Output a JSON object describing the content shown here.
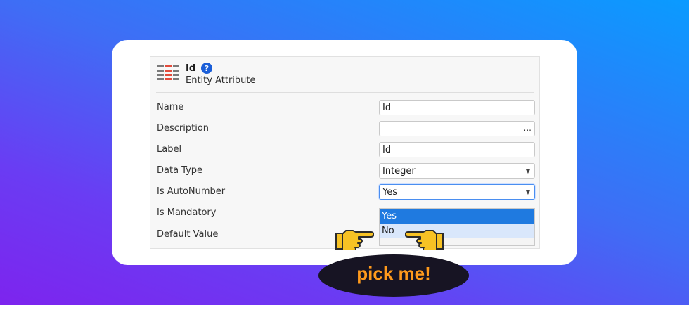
{
  "entity": {
    "title": "Id",
    "help": "?",
    "subtitle": "Entity Attribute"
  },
  "rows": {
    "name": {
      "label": "Name",
      "value": "Id"
    },
    "description": {
      "label": "Description",
      "value": "",
      "more": "..."
    },
    "label": {
      "label": "Label",
      "value": "Id"
    },
    "data_type": {
      "label": "Data Type",
      "value": "Integer"
    },
    "is_autonumber": {
      "label": "Is AutoNumber",
      "value": "Yes"
    },
    "is_mandatory": {
      "label": "Is Mandatory"
    },
    "default_value": {
      "label": "Default Value"
    }
  },
  "dropdown": {
    "options": [
      "Yes",
      "No"
    ],
    "selected": "Yes",
    "highlighted": "No"
  },
  "callout": {
    "text": "pick me!"
  },
  "colors": {
    "accent": "#1f7ae0",
    "callout_text": "#ff9a1c",
    "callout_bg": "#171423",
    "hand": "#f7c224"
  },
  "icons": [
    "entity-attribute-icon",
    "help-icon",
    "more-icon",
    "dropdown-caret-icon",
    "pointing-hand-icon"
  ]
}
